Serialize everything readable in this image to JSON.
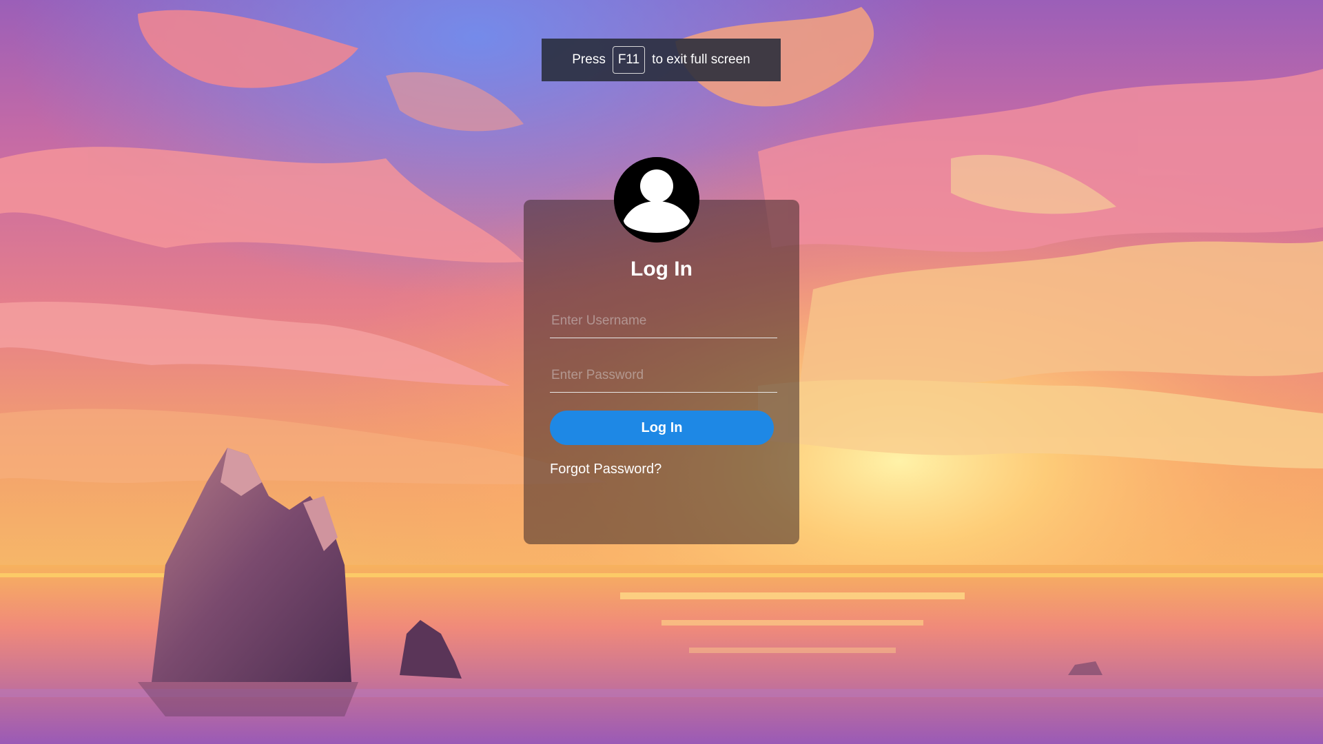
{
  "toast": {
    "prefix": "Press",
    "key": "F11",
    "suffix": "to exit full screen"
  },
  "login": {
    "avatar_icon": "user-avatar-icon",
    "title": "Log In",
    "username_placeholder": "Enter Username",
    "password_placeholder": "Enter Password",
    "button_label": "Log In",
    "forgot_label": "Forgot Password?"
  },
  "colors": {
    "button": "#1e88e5",
    "card": "rgba(60,40,40,0.55)",
    "sky_top": "#8a6fd6",
    "sunset": "#ffb347"
  }
}
